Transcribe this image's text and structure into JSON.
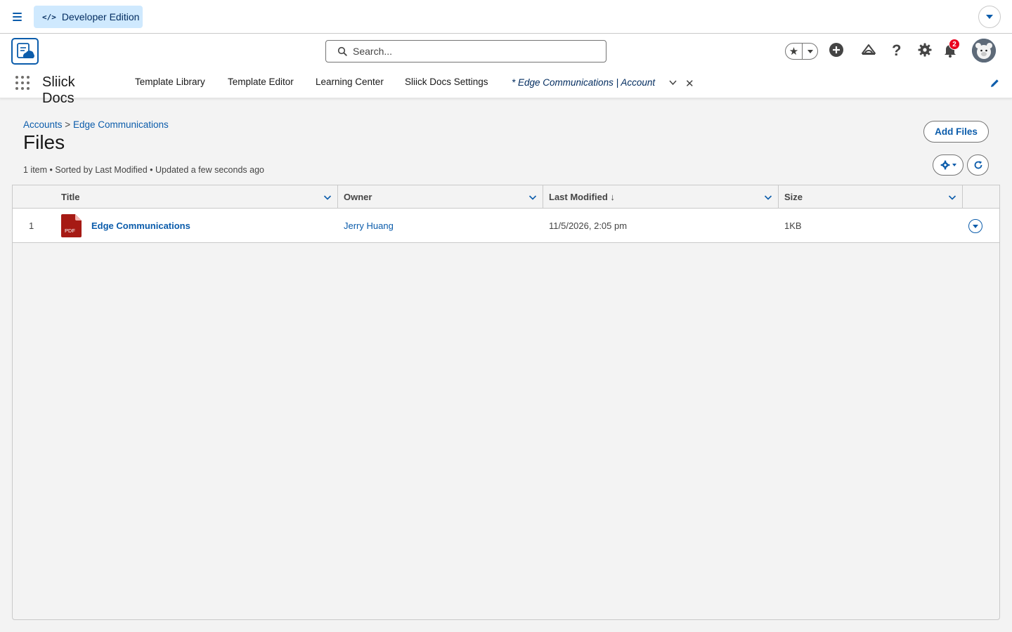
{
  "topbar": {
    "edition_label": "Developer Edition"
  },
  "header": {
    "search_placeholder": "Search...",
    "notification_count": "2"
  },
  "nav": {
    "app_name": "Sliick Docs",
    "items": [
      {
        "label": "Template Library"
      },
      {
        "label": "Template Editor"
      },
      {
        "label": "Learning Center"
      },
      {
        "label": "Sliick Docs Settings"
      }
    ],
    "active_tab": "* Edge Communications | Account"
  },
  "page": {
    "breadcrumb": {
      "parent": "Accounts",
      "separator": ">",
      "record": "Edge Communications"
    },
    "title": "Files",
    "meta": "1 item • Sorted by Last Modified • Updated a few seconds ago",
    "add_files_label": "Add Files"
  },
  "table": {
    "columns": [
      {
        "label": "Title"
      },
      {
        "label": "Owner"
      },
      {
        "label": "Last Modified ↓"
      },
      {
        "label": "Size"
      }
    ],
    "rows": [
      {
        "index": "1",
        "file_type": "PDF",
        "title": "Edge Communications",
        "owner": "Jerry Huang",
        "last_modified": "11/5/2026, 2:05 pm",
        "size": "1KB"
      }
    ]
  },
  "colors": {
    "brand_blue": "#0b5cab",
    "pdf_red": "#a61a14",
    "badge_red": "#ea001e"
  },
  "icons": [
    "menu-icon",
    "code-icon",
    "caret-down-icon",
    "search-icon",
    "star-icon",
    "plus-circle-icon",
    "trailhead-icon",
    "help-icon",
    "gear-icon",
    "bell-icon",
    "app-launcher-icon",
    "chevron-down-icon",
    "close-icon",
    "pencil-icon",
    "refresh-icon",
    "pdf-icon"
  ]
}
